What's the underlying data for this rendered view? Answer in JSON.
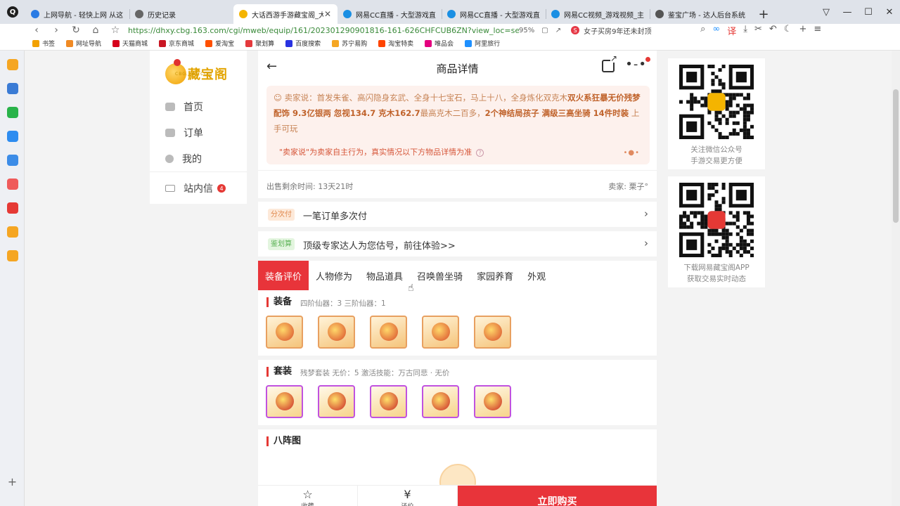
{
  "browser": {
    "tabs": [
      {
        "title": "上网导航 - 轻快上网 从这",
        "color": "#2a7be4",
        "active": false
      },
      {
        "title": "历史记录",
        "color": "#666666",
        "active": false
      },
      {
        "title": "大话西游手游藏宝阁_大",
        "color": "#f4b400",
        "active": true
      },
      {
        "title": "网易CC直播 - 大型游戏直",
        "color": "#1a8fe3",
        "active": false
      },
      {
        "title": "网易CC直播 - 大型游戏直",
        "color": "#1a8fe3",
        "active": false
      },
      {
        "title": "网易CC视频_游戏视频_主",
        "color": "#1a8fe3",
        "active": false
      },
      {
        "title": "鉴宝广场 - 达人后台系统",
        "color": "#555555",
        "active": false
      }
    ],
    "url": "https://dhxy.cbg.163.com/cgi/mweb/equip/161/202301290901816-161-626CHFCUB6ZN?view_loc=se",
    "zoom": "95%",
    "search_text": "女子买房9年还未封顶",
    "bookmarks": [
      {
        "label": "书签",
        "color": "#f2a100"
      },
      {
        "label": "网址导航",
        "color": "#f08a24"
      },
      {
        "label": "天猫商城",
        "color": "#d6001c"
      },
      {
        "label": "京东商城",
        "color": "#c91623"
      },
      {
        "label": "爱淘宝",
        "color": "#ff5000"
      },
      {
        "label": "聚划算",
        "color": "#e4393c"
      },
      {
        "label": "百度搜索",
        "color": "#2932e1"
      },
      {
        "label": "苏宁易购",
        "color": "#f5a623"
      },
      {
        "label": "淘宝特卖",
        "color": "#ff4400"
      },
      {
        "label": "唯品会",
        "color": "#e4007f"
      },
      {
        "label": "阿里旅行",
        "color": "#1e90ff"
      }
    ],
    "sidebar_icons": [
      {
        "name": "favorites-icon",
        "color": "#f5a623"
      },
      {
        "name": "chat-icon",
        "color": "#3a7bd5"
      },
      {
        "name": "wechat-icon",
        "color": "#29b34a"
      },
      {
        "name": "app-icon",
        "color": "#2d8cf0"
      },
      {
        "name": "cloud-icon",
        "color": "#3c8ce7"
      },
      {
        "name": "game-icon",
        "color": "#ef5b5b"
      },
      {
        "name": "pdf-icon",
        "color": "#e53935"
      },
      {
        "name": "search-tool-icon",
        "color": "#f5a623"
      },
      {
        "name": "folder-icon",
        "color": "#f5a623"
      }
    ]
  },
  "site_nav": {
    "logo_text": "藏宝阁",
    "logo_sub": "CBG.163.COM",
    "items": [
      {
        "label": "首页"
      },
      {
        "label": "订单"
      },
      {
        "label": "我的"
      },
      {
        "label": "站内信",
        "badge": "4"
      }
    ]
  },
  "page": {
    "title": "商品详情",
    "seller_says": {
      "prefix": "卖家说：首发朱雀、高闪隐身玄武、全身十七宝石，马上十八，全身炼化双克木",
      "b1": "双火系狂暴无价残梦配饰 9.3亿银两 忽视134.7 克木162.7",
      "mid": "最高克木二百多，",
      "b2": "2个神结局孩子 满级三高坐骑 14件时装",
      "suffix": "上手可玩",
      "note": "\"卖家说\"为卖家自主行为，真实情况以下方物品详情为准"
    },
    "time_left": "出售剩余时间: 13天21时",
    "seller": "卖家: 栗子°",
    "promos": [
      {
        "badge": "分次付",
        "text": "一笔订单多次付",
        "badge_bg": "#fde9d9",
        "badge_fg": "#e0864a"
      },
      {
        "badge": "鉴划算",
        "text": "顶级专家达人为您估号，前往体验>>",
        "badge_bg": "#e3f5df",
        "badge_fg": "#5bb255"
      }
    ],
    "tabs": [
      "装备评价",
      "人物修为",
      "物品道具",
      "召唤兽坐骑",
      "家园养育",
      "外观"
    ],
    "active_tab": 0,
    "equip": {
      "title": "装备",
      "sub": "四阶仙器：3    三阶仙器：1",
      "count": 5
    },
    "suit": {
      "title": "套装",
      "sub": "残梦套装    无价：5    激活技能：万古同悲 · 无价",
      "count": 5
    },
    "formation": {
      "title": "八阵图"
    },
    "bottom": {
      "fav": "收藏",
      "bargain": "还价",
      "buy": "立即购买"
    }
  },
  "qr": [
    {
      "caption1": "关注微信公众号",
      "caption2": "手游交易更方便"
    },
    {
      "caption1": "下载网易藏宝阁APP",
      "caption2": "获取交易实时动态"
    }
  ]
}
